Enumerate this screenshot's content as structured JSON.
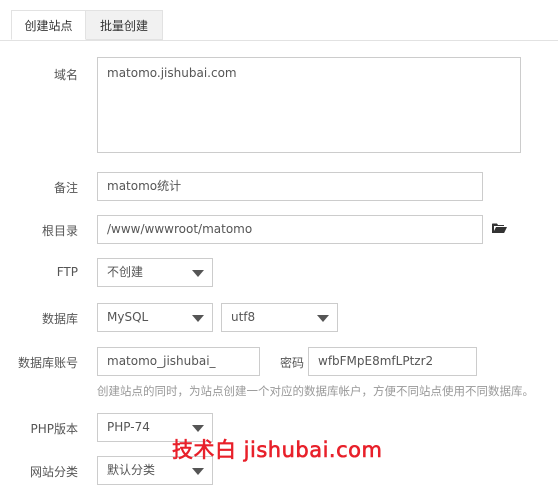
{
  "tabs": [
    "创建站点",
    "批量创建"
  ],
  "form": {
    "domain": {
      "label": "域名",
      "value": "matomo.jishubai.com"
    },
    "remark": {
      "label": "备注",
      "value": "matomo统计"
    },
    "root": {
      "label": "根目录",
      "value": "/www/wwwroot/matomo",
      "icon": "folder-open-icon"
    },
    "ftp": {
      "label": "FTP",
      "value": "不创建"
    },
    "database": {
      "label": "数据库",
      "type": "MySQL",
      "charset": "utf8"
    },
    "db_account": {
      "label": "数据库账号",
      "user": "matomo_jishubai_",
      "password_label": "密码",
      "password": "wfbFMpE8mfLPtzr2"
    },
    "hint": "创建站点的同时，为站点创建一个对应的数据库帐户，方便不同站点使用不同数据库。",
    "php": {
      "label": "PHP版本",
      "value": "PHP-74"
    },
    "category": {
      "label": "网站分类",
      "value": "默认分类"
    }
  },
  "watermark": "技术白 jishubai.com",
  "colors": {
    "watermark": "#e8202a",
    "border": "#cccccc",
    "hint": "#999999"
  }
}
